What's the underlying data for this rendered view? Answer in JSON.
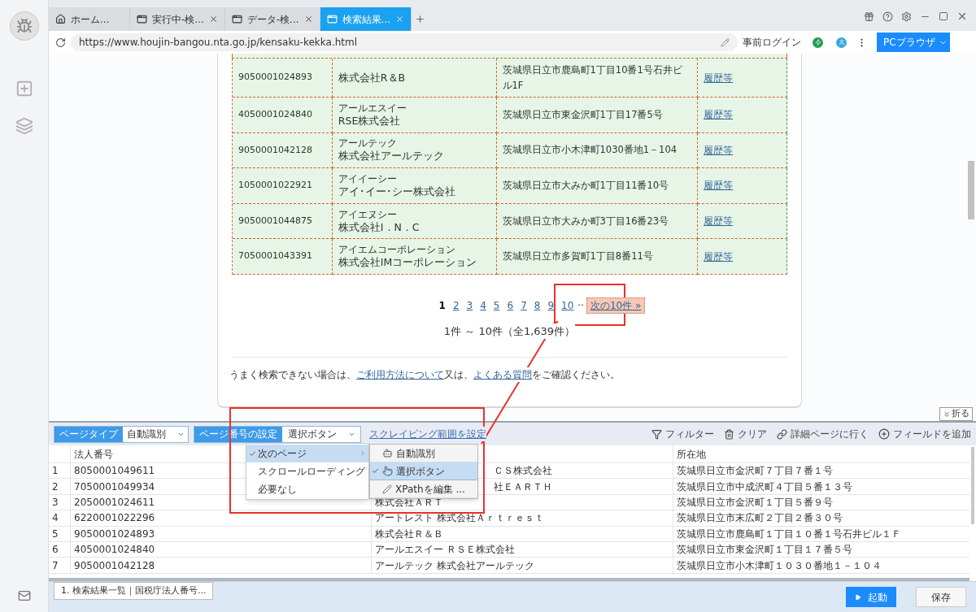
{
  "browser": {
    "tabs": [
      {
        "label": "ホーム...",
        "kind": "home",
        "selected": false
      },
      {
        "label": "実行中-検...",
        "kind": "page",
        "selected": false
      },
      {
        "label": "データ-検...",
        "kind": "page",
        "selected": false
      },
      {
        "label": "検索結果...",
        "kind": "page",
        "selected": true
      }
    ],
    "url": "https://www.houjin-bangou.nta.go.jp/kensaku-kekka.html",
    "login_label": "事前ログイン",
    "mode_button": "PCブラウザ"
  },
  "page": {
    "results": [
      {
        "number": "9050001024893",
        "name": "株式会社R＆B",
        "address": "茨城県日立市鹿島町1丁目10番1号石井ビル1F",
        "link": "履歴等"
      },
      {
        "number": "4050001024840",
        "kana": "アールエスイー",
        "name": "RSE株式会社",
        "address": "茨城県日立市東金沢町1丁目17番5号",
        "link": "履歴等"
      },
      {
        "number": "9050001042128",
        "kana": "アールテック",
        "name": "株式会社アールテック",
        "address": "茨城県日立市小木津町1030番地1－104",
        "link": "履歴等"
      },
      {
        "number": "1050001022921",
        "kana": "アイイーシー",
        "name": "アイ･イー･シー株式会社",
        "address": "茨城県日立市大みか町1丁目11番10号",
        "link": "履歴等"
      },
      {
        "number": "9050001044875",
        "kana": "アイエヌシー",
        "name": "株式会社I．N．C",
        "address": "茨城県日立市大みか町3丁目16番23号",
        "link": "履歴等"
      },
      {
        "number": "7050001043391",
        "kana": "アイエムコーポレーション",
        "name": "株式会社IMコーポレーション",
        "address": "茨城県日立市多賀町1丁目8番11号",
        "link": "履歴等"
      }
    ],
    "pagination": {
      "pages": [
        {
          "label": "1",
          "selected": true
        },
        {
          "label": "2",
          "selected": false
        },
        {
          "label": "3",
          "selected": false
        },
        {
          "label": "4",
          "selected": false
        },
        {
          "label": "5",
          "selected": false
        },
        {
          "label": "6",
          "selected": false
        },
        {
          "label": "7",
          "selected": false
        },
        {
          "label": "8",
          "selected": false
        },
        {
          "label": "9",
          "selected": false
        },
        {
          "label": "10",
          "selected": false
        }
      ],
      "ellipsis": "··",
      "next": "次の10件 »"
    },
    "count": "1件 ～ 10件（全1,639件）",
    "help_text": [
      {
        "kind": "text",
        "text": "うまく検索できない場合は、"
      },
      {
        "kind": "link",
        "text": "ご利用方法について"
      },
      {
        "kind": "text",
        "text": "又は、"
      },
      {
        "kind": "link",
        "text": "よくある質問"
      },
      {
        "kind": "text",
        "text": "をご確認ください。"
      }
    ],
    "collapse_button": "折る"
  },
  "scraper": {
    "page_type": {
      "label": "ページタイプ",
      "value": "自動識別"
    },
    "pagination_setting": {
      "label": "ページ番号の設定",
      "value": "選択ボタン"
    },
    "range_link": "スクレイピング範囲を設定",
    "actions": [
      {
        "label": "フィルター",
        "kind": "filter"
      },
      {
        "label": "クリア",
        "kind": "clear"
      },
      {
        "label": "詳細ページに行く",
        "kind": "link"
      },
      {
        "label": "フィールドを追加",
        "kind": "add"
      }
    ],
    "menu": {
      "items": [
        {
          "label": "次のページ",
          "checked": true,
          "selected": true,
          "has_submenu": true
        },
        {
          "label": "スクロールローディング",
          "checked": false,
          "selected": false,
          "has_submenu": false
        },
        {
          "label": "必要なし",
          "checked": false,
          "selected": false,
          "has_submenu": false
        }
      ],
      "submenu": [
        {
          "label": "自動識別",
          "kind": "auto",
          "checked": false,
          "selected": false
        },
        {
          "label": "選択ボタン",
          "kind": "click",
          "checked": true,
          "selected": true
        },
        {
          "label": "XPathを編集 ...",
          "kind": "xpath",
          "checked": false,
          "selected": false
        }
      ]
    },
    "table": {
      "header": {
        "number": "法人番号",
        "address": "所在地"
      },
      "rows": [
        {
          "index": "1",
          "number": "8050001049611",
          "company": "ＣＳ株式会社",
          "address": "茨城県日立市金沢町７丁目７番１号"
        },
        {
          "index": "2",
          "number": "7050001049934",
          "company": "社ＥＡＲＴＨ",
          "address": "茨城県日立市中成沢町４丁目５番１３号"
        },
        {
          "index": "3",
          "number": "2050001024611",
          "company": "株式会社ＡＲＴ",
          "address": "茨城県日立市金沢町１丁目５番９号"
        },
        {
          "index": "4",
          "number": "6220001022296",
          "company": "アートレスト 株式会社Ａｒｔｒｅｓｔ",
          "address": "茨城県日立市末広町２丁目２番３０号"
        },
        {
          "index": "5",
          "number": "9050001024893",
          "company": "株式会社Ｒ＆Ｂ",
          "address": "茨城県日立市鹿島町１丁目１０番１号石井ビル１Ｆ"
        },
        {
          "index": "6",
          "number": "4050001024840",
          "company": "アールエスイー ＲＳＥ株式会社",
          "address": "茨城県日立市東金沢町１丁目１７番５号"
        },
        {
          "index": "7",
          "number": "9050001042128",
          "company": "アールテック 株式会社アールテック",
          "address": "茨城県日立市小木津町１０３０番地１－１０４"
        }
      ]
    }
  },
  "footer": {
    "task_tab": "1. 検索結果一覧｜国税庁法人番号...",
    "start_button": "起動",
    "save_button": "保存"
  }
}
